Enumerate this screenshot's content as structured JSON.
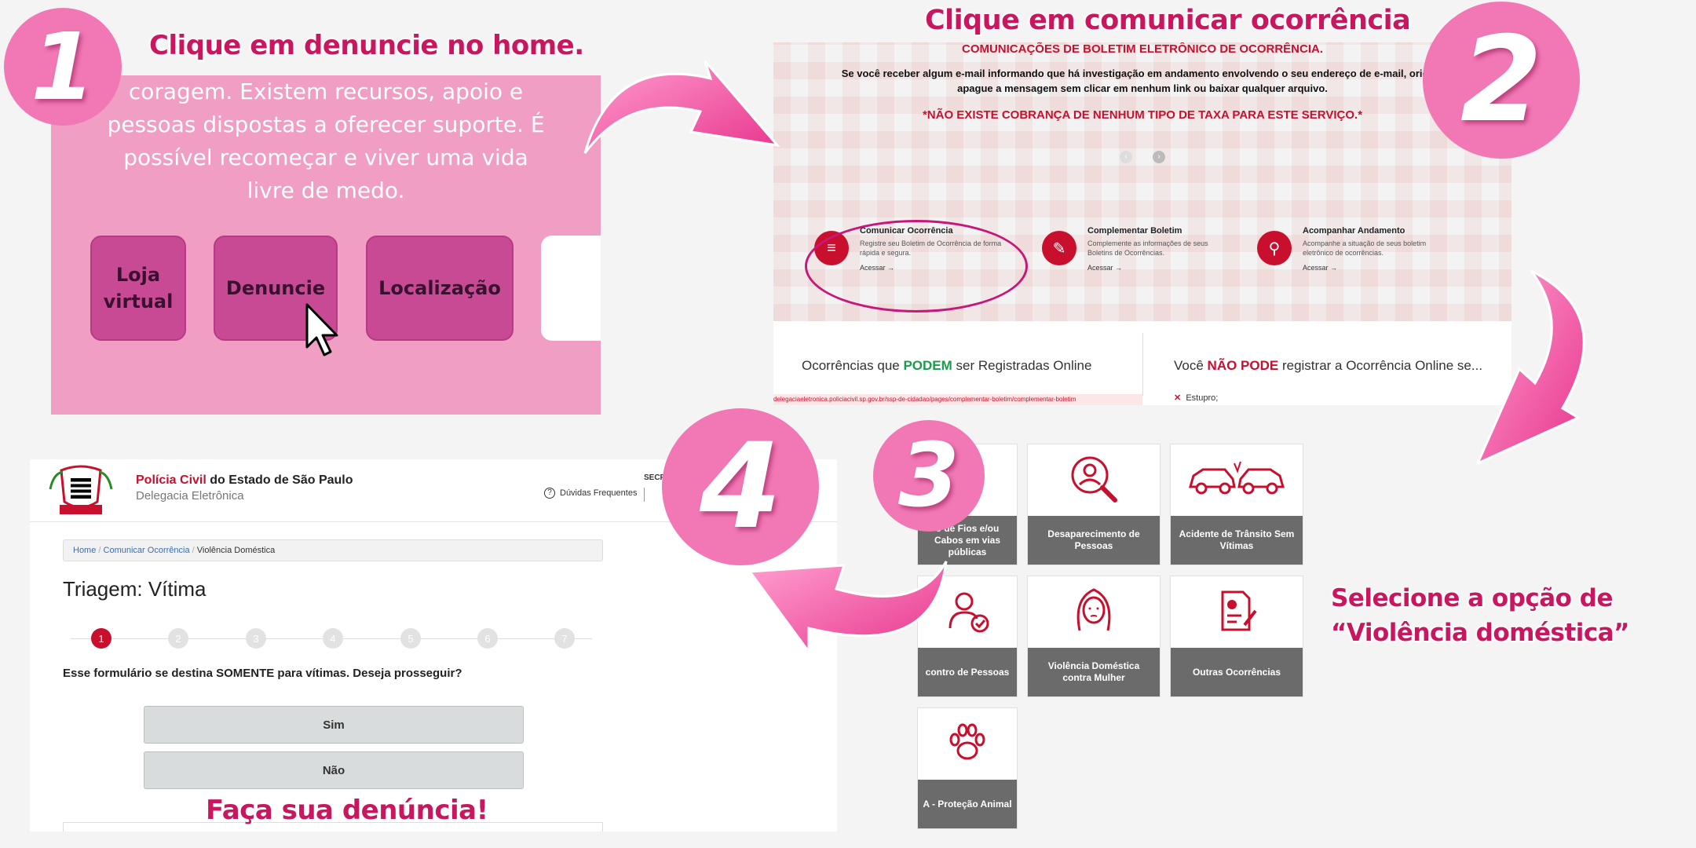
{
  "colors": {
    "accent_pink": "#c8175f",
    "circle_pink": "#f277b5",
    "police_red": "#c8102e",
    "ok_green": "#1a9b4e"
  },
  "steps": [
    {
      "number": "1",
      "caption": "Clique em denuncie no home."
    },
    {
      "number": "2",
      "caption": "Clique em comunicar ocorrência"
    },
    {
      "number": "3",
      "caption": "Selecione a opção de “Violência doméstica”"
    },
    {
      "number": "4",
      "caption": "Faça sua denúncia!"
    }
  ],
  "panel1": {
    "text_lines": [
      "coragem. Existem recursos, apoio e",
      "pessoas dispostas a oferecer suporte. É",
      "possível recomeçar e viver uma vida",
      "livre de medo."
    ],
    "buttons": {
      "store": "Loja virtual",
      "report": "Denuncie",
      "location": "Localização"
    },
    "phone_icon": "phone-icon"
  },
  "panel2": {
    "banner_title": "COMUNICAÇÕES DE BOLETIM ELETRÔNICO DE OCORRÊNCIA.",
    "warning_line1": "Se você receber algum e-mail informando que há investigação em andamento envolvendo o seu endereço de e-mail, orienta",
    "warning_line2": "apague a mensagem sem clicar em nenhum link ou baixar qualquer arquivo.",
    "no_fee": "*NÃO EXISTE COBRANÇA DE NENHUM TIPO DE TAXA PARA ESTE SERVIÇO.*",
    "services": [
      {
        "title": "Comunicar Ocorrência",
        "desc1": "Registre seu Boletim de Ocorrência de forma",
        "desc2": "rápida e segura.",
        "link": "Acessar →",
        "icon": "list-icon"
      },
      {
        "title": "Complementar Boletim",
        "desc1": "Complemente as informações de seus",
        "desc2": "Boletins de Ocorrências.",
        "link": "Acessar →",
        "icon": "pencil-icon"
      },
      {
        "title": "Acompanhar Andamento",
        "desc1": "Acompanhe a situação de seus boletim",
        "desc2": "eletrônico de ocorrências.",
        "link": "Acessar →",
        "icon": "search-icon"
      }
    ],
    "can_prefix": "Ocorrências que ",
    "can_word": "PODEM",
    "can_suffix": " ser Registradas Online",
    "cannot_prefix": "Você ",
    "cannot_word": "NÃO PODE",
    "cannot_suffix": " registrar a Ocorrência Online se...",
    "url": "delegaciaeletronica.policiacivil.sp.gov.br/ssp-de-cidadao/pages/complementar-boletim/complementar-boletim",
    "cannot_item": "Estupro;"
  },
  "panel3": {
    "tiles": [
      {
        "label": "o de Fios e/ou Cabos em vias públicas",
        "icon": "house-icon"
      },
      {
        "label": "Desaparecimento de Pessoas",
        "icon": "person-search-icon"
      },
      {
        "label": "Acidente de Trânsito Sem Vítimas",
        "icon": "car-crash-icon"
      },
      {
        "label": "contro de Pessoas",
        "icon": "person-check-icon"
      },
      {
        "label": "Violência Doméstica contra Mulher",
        "icon": "woman-icon"
      },
      {
        "label": "Outras Ocorrências",
        "icon": "document-icon"
      },
      {
        "label": "A - Proteção Animal",
        "icon": "paw-icon"
      }
    ]
  },
  "panel4": {
    "org_name_red": "Polícia Civil",
    "org_name_rest": " do Estado de São Paulo",
    "org_subtitle": "Delegacia Eletrônica",
    "faq": "Dúvidas Frequentes",
    "header_cut": "SECR",
    "breadcrumb": [
      "Home",
      "Comunicar Ocorrência",
      "Violência Doméstica"
    ],
    "page_title": "Triagem: Vítima",
    "stepper": [
      "1",
      "2",
      "3",
      "4",
      "5",
      "6",
      "7"
    ],
    "question": "Esse formulário se destina SOMENTE para vítimas. Deseja prosseguir?",
    "yes": "Sim",
    "no": "Não"
  }
}
